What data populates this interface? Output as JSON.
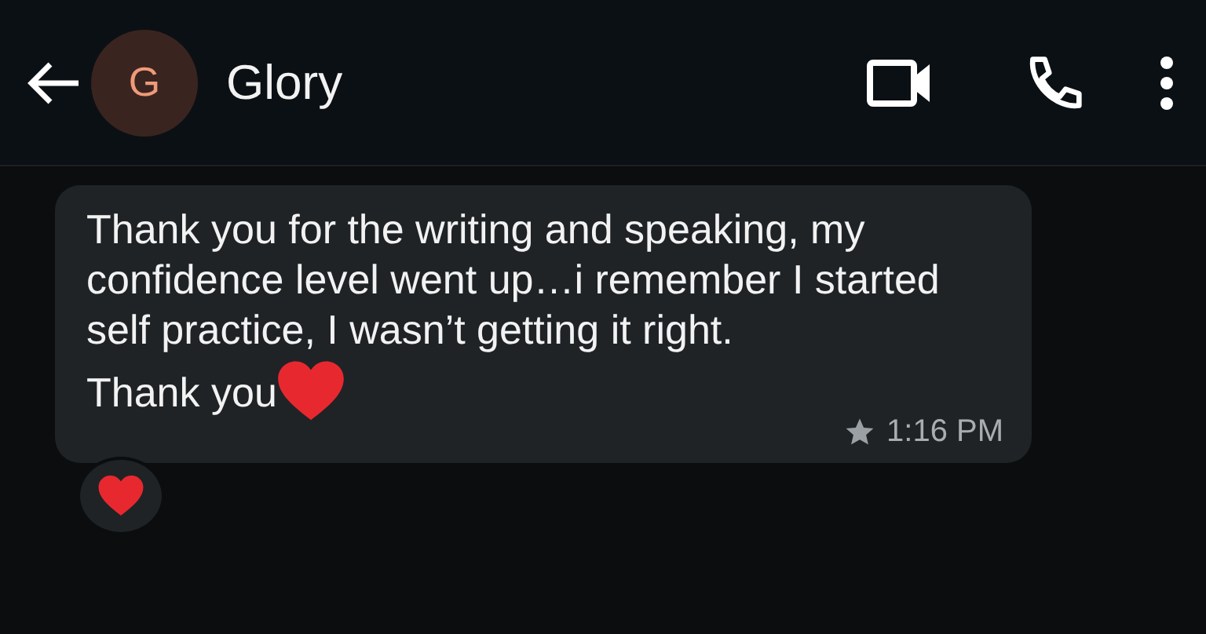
{
  "header": {
    "avatar_letter": "G",
    "title": "Glory"
  },
  "message": {
    "paragraphs": [
      "Thank you for the writing and speaking, my confidence level went up…i remember I started self practice, I wasn’t getting it right.",
      "Thank you"
    ],
    "starred": true,
    "time": "1:16 PM"
  },
  "reaction": {
    "kind": "heart"
  }
}
